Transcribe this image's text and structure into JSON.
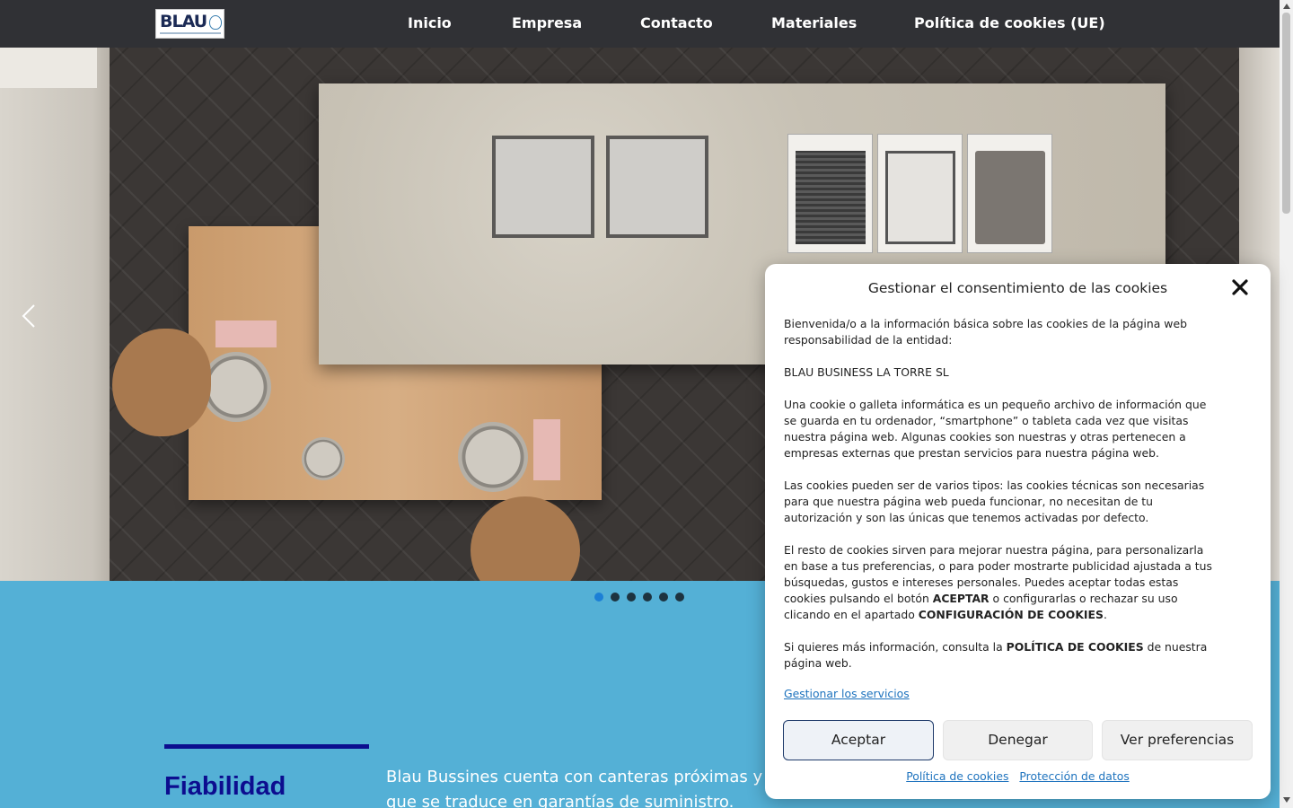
{
  "header": {
    "logo_text": "BLAU",
    "nav": [
      "Inicio",
      "Empresa",
      "Contacto",
      "Materiales",
      "Política de cookies (UE)"
    ]
  },
  "hero": {
    "prev_icon": "chevron-left-icon",
    "slide_count": 6,
    "active_slide": 1
  },
  "section": {
    "title": "Fiabilidad",
    "text": "Blau Bussines cuenta con canteras próximas y distribución, lo que se traduce en garantías de suministro."
  },
  "cookie": {
    "title": "Gestionar el consentimiento de las cookies",
    "close_icon": "close-icon",
    "p1": "Bienvenida/o a la información básica sobre las cookies de la página web responsabilidad de la entidad:",
    "p2": "BLAU BUSINESS LA TORRE SL",
    "p3": "Una cookie o galleta informática es un pequeño archivo de información que se guarda en tu ordenador, “smartphone” o tableta cada vez que visitas nuestra página web. Algunas cookies son nuestras y otras pertenecen a empresas externas que prestan servicios para nuestra página web.",
    "p4": "Las cookies pueden ser de varios tipos: las cookies técnicas son necesarias para que nuestra página web pueda funcionar, no necesitan de tu autorización y son las únicas que tenemos activadas por defecto.",
    "p5_a": "El resto de cookies sirven para mejorar nuestra página, para personalizarla en base a tus preferencias, o para poder mostrarte publicidad ajustada a tus búsquedas, gustos e intereses personales. Puedes aceptar todas estas cookies pulsando el botón ",
    "p5_b": "ACEPTAR",
    "p5_c": " o configurarlas o rechazar su uso clicando en el apartado ",
    "p5_d": "CONFIGURACIÓN DE COOKIES",
    "p5_e": ".",
    "p6_a": "Si quieres más información, consulta la ",
    "p6_b": "POLÍTICA DE COOKIES",
    "p6_c": " de nuestra página web.",
    "manage_link": "Gestionar los servicios",
    "btn_accept": "Aceptar",
    "btn_deny": "Denegar",
    "btn_prefs": "Ver preferencias",
    "link_policy": "Política de cookies",
    "link_privacy": "Protección de datos"
  },
  "colors": {
    "header_bg": "#303135",
    "section_bg": "#54b0d6",
    "title_blue": "#0c0d8f",
    "dot_active": "#1c7fd6",
    "link": "#1e73be"
  }
}
